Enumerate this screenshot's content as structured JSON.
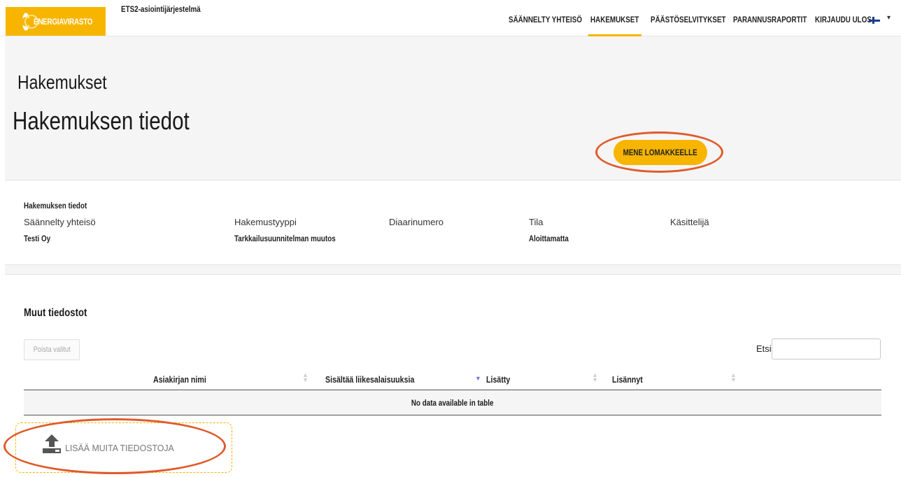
{
  "header": {
    "logo_text": "ENERGIAVIRASTO",
    "system_title": "ETS2-asiointijärjestelmä",
    "nav": [
      {
        "label": "SÄÄNNELTY YHTEISÖ",
        "active": false
      },
      {
        "label": "HAKEMUKSET",
        "active": true
      },
      {
        "label": "PÄÄSTÖSELVITYKSET",
        "active": false
      },
      {
        "label": "PARANNUSRAPORTIT",
        "active": false
      },
      {
        "label": "KIRJAUDU ULOS",
        "active": false
      }
    ],
    "language_flag": "finnish-flag-icon",
    "accent_color": "#f7b500"
  },
  "page": {
    "section_title": "Hakemukset",
    "title": "Hakemuksen tiedot",
    "go_to_form_label": "MENE LOMAKKEELLE"
  },
  "details": {
    "heading": "Hakemuksen tiedot",
    "fields": [
      {
        "label": "Säännelty yhteisö",
        "value": "Testi Oy"
      },
      {
        "label": "Hakemustyyppi",
        "value": "Tarkkailusuunnitelman muutos"
      },
      {
        "label": "Diaarinumero",
        "value": ""
      },
      {
        "label": "Tila",
        "value": "Aloittamatta"
      },
      {
        "label": "Käsittelijä",
        "value": ""
      }
    ]
  },
  "files": {
    "title": "Muut tiedostot",
    "delete_selected_label": "Poista valitut",
    "search_label": "Etsi",
    "search_value": "",
    "columns": [
      "Asiakirjan nimi",
      "Sisältää liikesalaisuuksia",
      "Lisätty",
      "Lisännyt"
    ],
    "sorted_column": "Sisältää liikesalaisuuksia",
    "rows": [],
    "empty_text": "No data available in table",
    "upload_label": "LISÄÄ MUITA TIEDOSTOJA"
  },
  "annotation_color": "#e05a2b"
}
